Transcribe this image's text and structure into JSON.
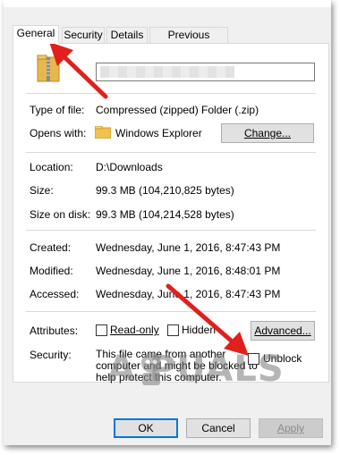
{
  "tabs": [
    {
      "label": "General",
      "active": true
    },
    {
      "label": "Security"
    },
    {
      "label": "Details"
    },
    {
      "label": "Previous Versions"
    }
  ],
  "file": {
    "name": "",
    "type_label": "Type of file:",
    "type_value": "Compressed (zipped) Folder (.zip)",
    "opens_label": "Opens with:",
    "opens_value": "Windows Explorer",
    "change_button": "Change...",
    "location_label": "Location:",
    "location_value": "D:\\Downloads",
    "size_label": "Size:",
    "size_value": "99.3 MB (104,210,825 bytes)",
    "size_on_disk_label": "Size on disk:",
    "size_on_disk_value": "99.3 MB (104,214,528 bytes)",
    "created_label": "Created:",
    "created_value": "Wednesday, June 1, 2016, 8:47:43 PM",
    "modified_label": "Modified:",
    "modified_value": "Wednesday, June 1, 2016, 8:48:01 PM",
    "accessed_label": "Accessed:",
    "accessed_value": "Wednesday, June 1, 2016, 8:47:43 PM"
  },
  "attributes": {
    "label": "Attributes:",
    "readonly": "Read-only",
    "readonly_checked": false,
    "hidden": "Hidden",
    "hidden_checked": false,
    "advanced_button": "Advanced..."
  },
  "security": {
    "label": "Security:",
    "text": [
      "This file came from another",
      "computer and might be blocked to",
      "help protect this computer."
    ],
    "unblock": "Unblock",
    "unblock_checked": false
  },
  "buttons": {
    "ok": "OK",
    "cancel": "Cancel",
    "apply": "Apply"
  },
  "watermark": "A  PUALS",
  "colors": {
    "arrow": "#e0201c",
    "accent": "#0078d7"
  }
}
